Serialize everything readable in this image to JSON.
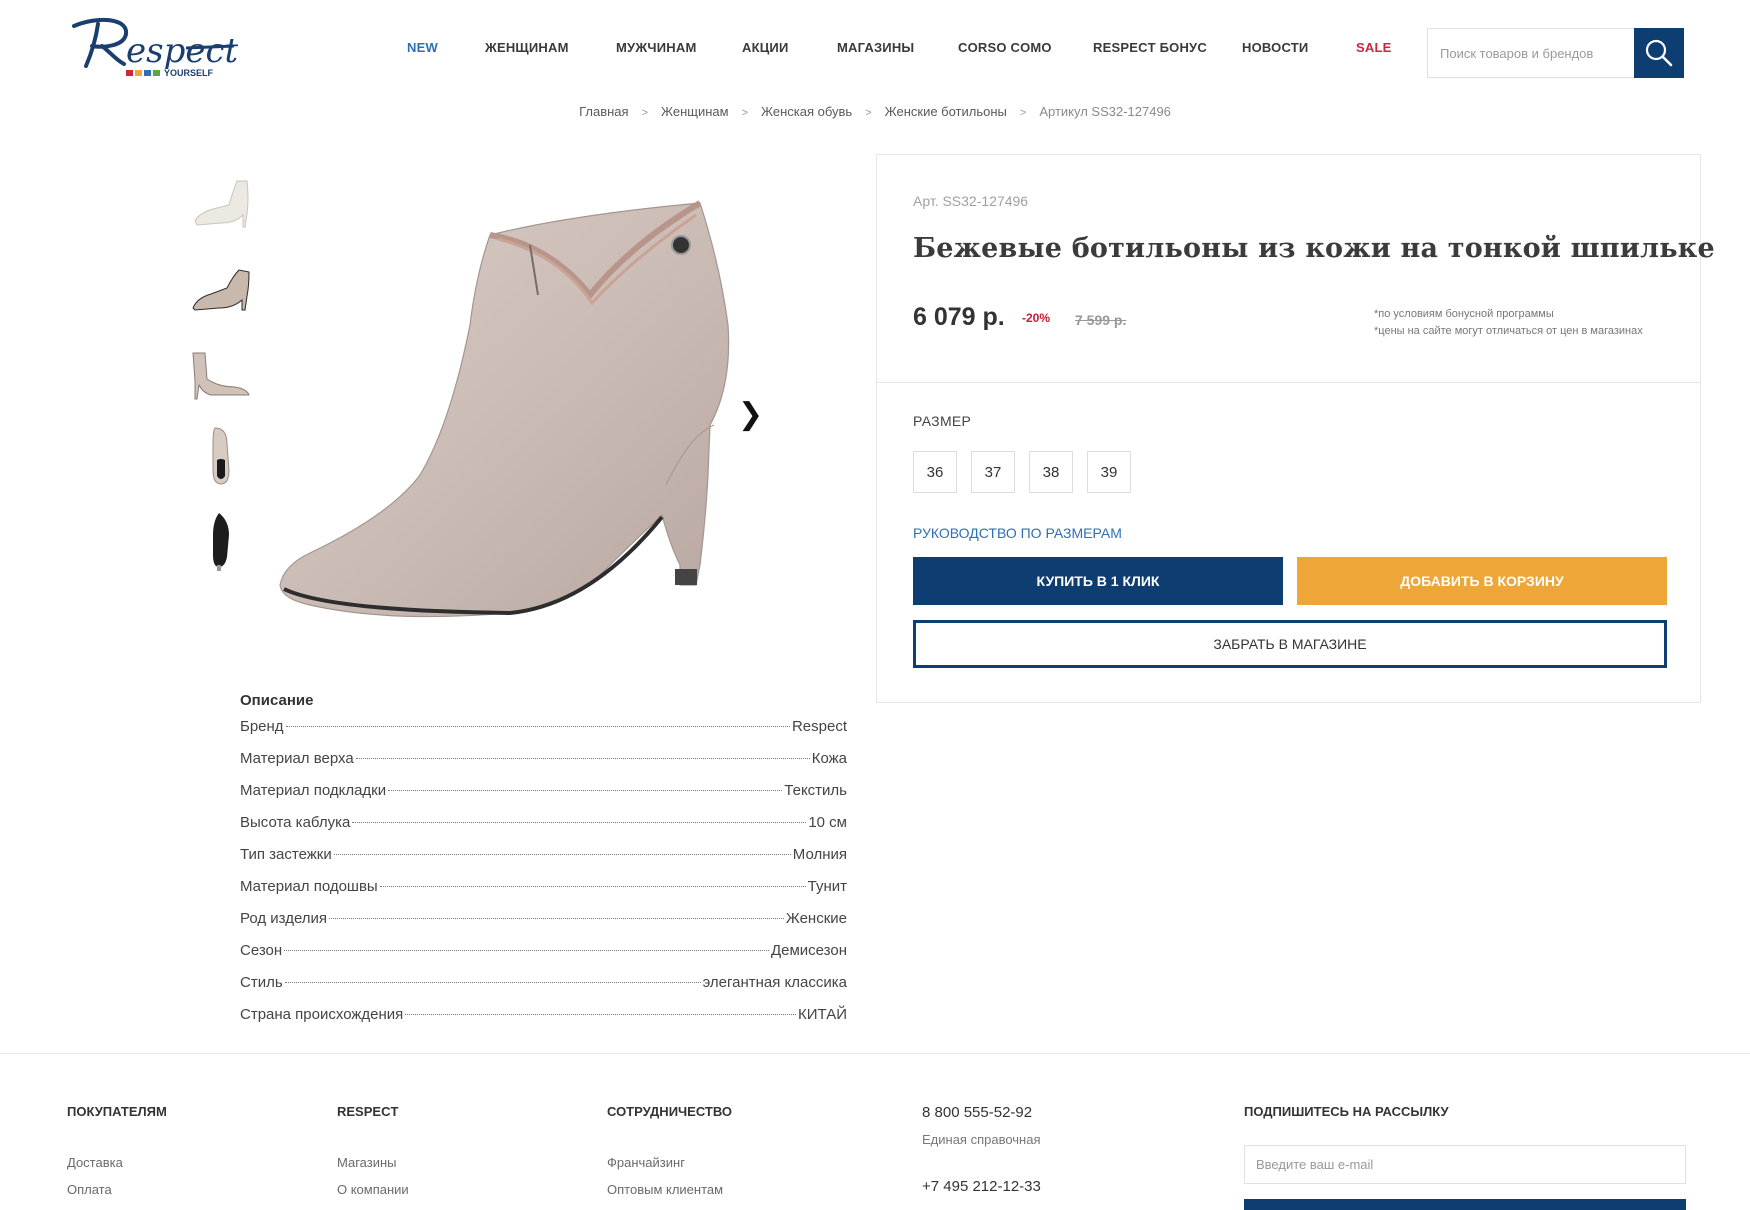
{
  "logo": {
    "text": "Respect",
    "sub": "YOURSELF"
  },
  "nav": {
    "items": [
      {
        "label": "NEW"
      },
      {
        "label": "ЖЕНЩИНАМ"
      },
      {
        "label": "МУЖЧИНАМ"
      },
      {
        "label": "АКЦИИ"
      },
      {
        "label": "МАГАЗИНЫ"
      },
      {
        "label": "CORSO COMO"
      },
      {
        "label": "RESPECT БОНУС"
      },
      {
        "label": "НОВОСТИ"
      },
      {
        "label": "SALE"
      }
    ]
  },
  "search": {
    "placeholder": "Поиск товаров и брендов",
    "icon": "search-icon"
  },
  "breadcrumb": {
    "items": [
      "Главная",
      "Женщинам",
      "Женская обувь",
      "Женские ботильоны"
    ],
    "current": "Артикул SS32-127496"
  },
  "gallery": {
    "next_icon": "chevron-right-icon",
    "next_glyph": "❯"
  },
  "description": {
    "title": "Описание",
    "specs": [
      {
        "key": "Бренд",
        "value": "Respect"
      },
      {
        "key": "Материал верха",
        "value": "Кожа"
      },
      {
        "key": "Материал подкладки",
        "value": "Текстиль"
      },
      {
        "key": "Высота каблука",
        "value": "10 см"
      },
      {
        "key": "Тип застежки",
        "value": "Молния"
      },
      {
        "key": "Материал подошвы",
        "value": "Тунит"
      },
      {
        "key": "Род изделия",
        "value": "Женские"
      },
      {
        "key": "Сезон",
        "value": "Демисезон"
      },
      {
        "key": "Стиль",
        "value": "элегантная классика"
      },
      {
        "key": "Страна происхождения",
        "value": "КИТАЙ"
      }
    ]
  },
  "product": {
    "sku": "Арт. SS32-127496",
    "title": "Бежевые ботильоны из кожи на тонкой шпильке",
    "price": "6 079 р.",
    "discount": "-20%",
    "old_price": "7 599 р.",
    "note1": "*по условиям бонусной программы",
    "note2": "*цены на сайте могут отличаться от цен в магазинах",
    "size_label": "РАЗМЕР",
    "sizes": [
      "36",
      "37",
      "38",
      "39"
    ],
    "size_guide": "РУКОВОДСТВО ПО РАЗМЕРАМ",
    "buy_one_click": "КУПИТЬ В 1 КЛИК",
    "add_to_cart": "ДОБАВИТЬ В КОРЗИНУ",
    "pickup": "ЗАБРАТЬ В МАГАЗИНЕ"
  },
  "footer": {
    "buyers": {
      "title": "ПОКУПАТЕЛЯМ",
      "links": [
        "Доставка",
        "Оплата"
      ]
    },
    "respect": {
      "title": "RESPECT",
      "links": [
        "Магазины",
        "О компании"
      ]
    },
    "partners": {
      "title": "СОТРУДНИЧЕСТВО",
      "links": [
        "Франчайзинг",
        "Оптовым клиентам"
      ]
    },
    "contacts": {
      "phone1": "8 800 555-52-92",
      "phone1_label": "Единая справочная",
      "phone2": "+7 495 212-12-33"
    },
    "subscribe": {
      "title": "ПОДПИШИТЕСЬ НА РАССЫЛКУ",
      "placeholder": "Введите ваш e-mail"
    }
  },
  "colors": {
    "brand_blue": "#0e3d72",
    "accent_orange": "#eda637",
    "sale_red": "#d0243f",
    "link_blue": "#2f6fb5"
  }
}
